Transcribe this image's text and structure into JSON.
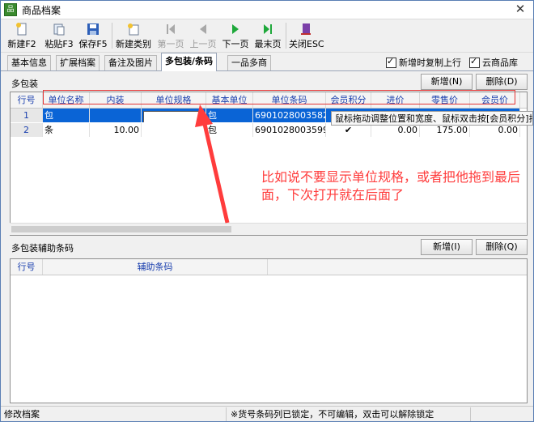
{
  "window": {
    "title": "商品档案"
  },
  "toolbar": {
    "new": "新建F2",
    "paste": "粘贴F3",
    "save": "保存F5",
    "new_category": "新建类别",
    "first": "第一页",
    "prev": "上一页",
    "next": "下一页",
    "last": "最末页",
    "close": "关闭ESC"
  },
  "tabs": [
    "基本信息",
    "扩展档案",
    "备注及图片",
    "多包装/条码",
    "一品多商"
  ],
  "options": {
    "copy_on_new": "新增时复制上行",
    "cloud_lib": "云商品库"
  },
  "packaging": {
    "title": "多包装",
    "add": "新增(N)",
    "delete": "删除(D)",
    "columns": [
      "行号",
      "单位名称",
      "内装",
      "单位规格",
      "基本单位",
      "单位条码",
      "会员积分",
      "进价",
      "零售价",
      "会员价"
    ],
    "rows": [
      {
        "no": "1",
        "unit": "包",
        "inner": "",
        "spec": "",
        "base": "包",
        "barcode": "6901028003582",
        "points": "",
        "cost": "",
        "retail": "",
        "member": ""
      },
      {
        "no": "2",
        "unit": "条",
        "inner": "10.00",
        "spec": "",
        "base": "包",
        "barcode": "6901028003599",
        "points": "✔",
        "cost": "0.00",
        "retail": "175.00",
        "member": "0.00"
      }
    ],
    "tooltip": "鼠标拖动调整位置和宽度、鼠标双击按[会员积分]排"
  },
  "aux": {
    "title": "多包装辅助条码",
    "add": "新增(I)",
    "delete": "删除(Q)",
    "columns": [
      "行号",
      "辅助条码"
    ]
  },
  "annotation": "比如说不要显示单位规格，或者把他拖到最后面，下次打开就在后面了",
  "status": {
    "left": "修改档案",
    "middle": "※货号条码列已锁定，不可编辑，双击可以解除锁定"
  },
  "colors": {
    "selection": "#0a64d6",
    "annotation": "#ff3c3c",
    "header_text": "#1a3fae"
  }
}
